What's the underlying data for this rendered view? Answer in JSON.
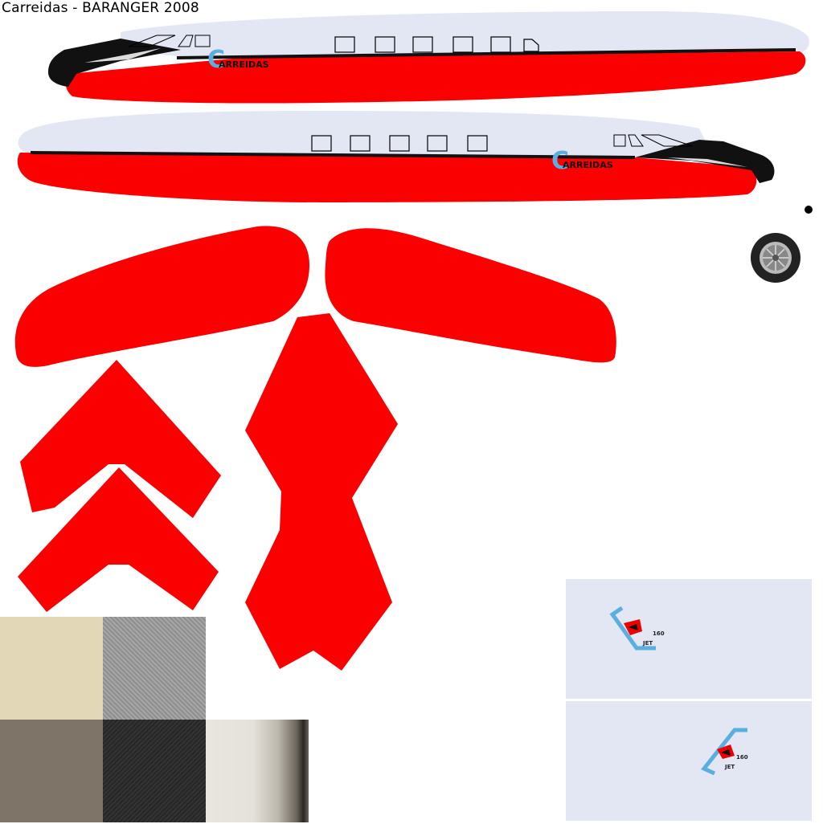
{
  "title": "Carreidas - BARANGER 2008",
  "livery": {
    "brand_name": "ARREIDAS",
    "brand_initial": "C",
    "colors": {
      "body_red": "#fa0000",
      "body_white": "#e3e6f3",
      "nose_black": "#111111",
      "brand_blue": "#5aaee0",
      "window_outline": "#000000"
    }
  },
  "decals": {
    "model_number": "160",
    "model_suffix": "JET"
  },
  "swatches": [
    {
      "name": "beige",
      "color": "#e2d8b8"
    },
    {
      "name": "grey-concrete",
      "color": "#9a9a9a"
    },
    {
      "name": "brown-grey",
      "color": "#7e7468"
    },
    {
      "name": "dark-concrete",
      "color": "#2c2c2c"
    },
    {
      "name": "exhaust-gradient",
      "color": "#e8e6df"
    }
  ]
}
